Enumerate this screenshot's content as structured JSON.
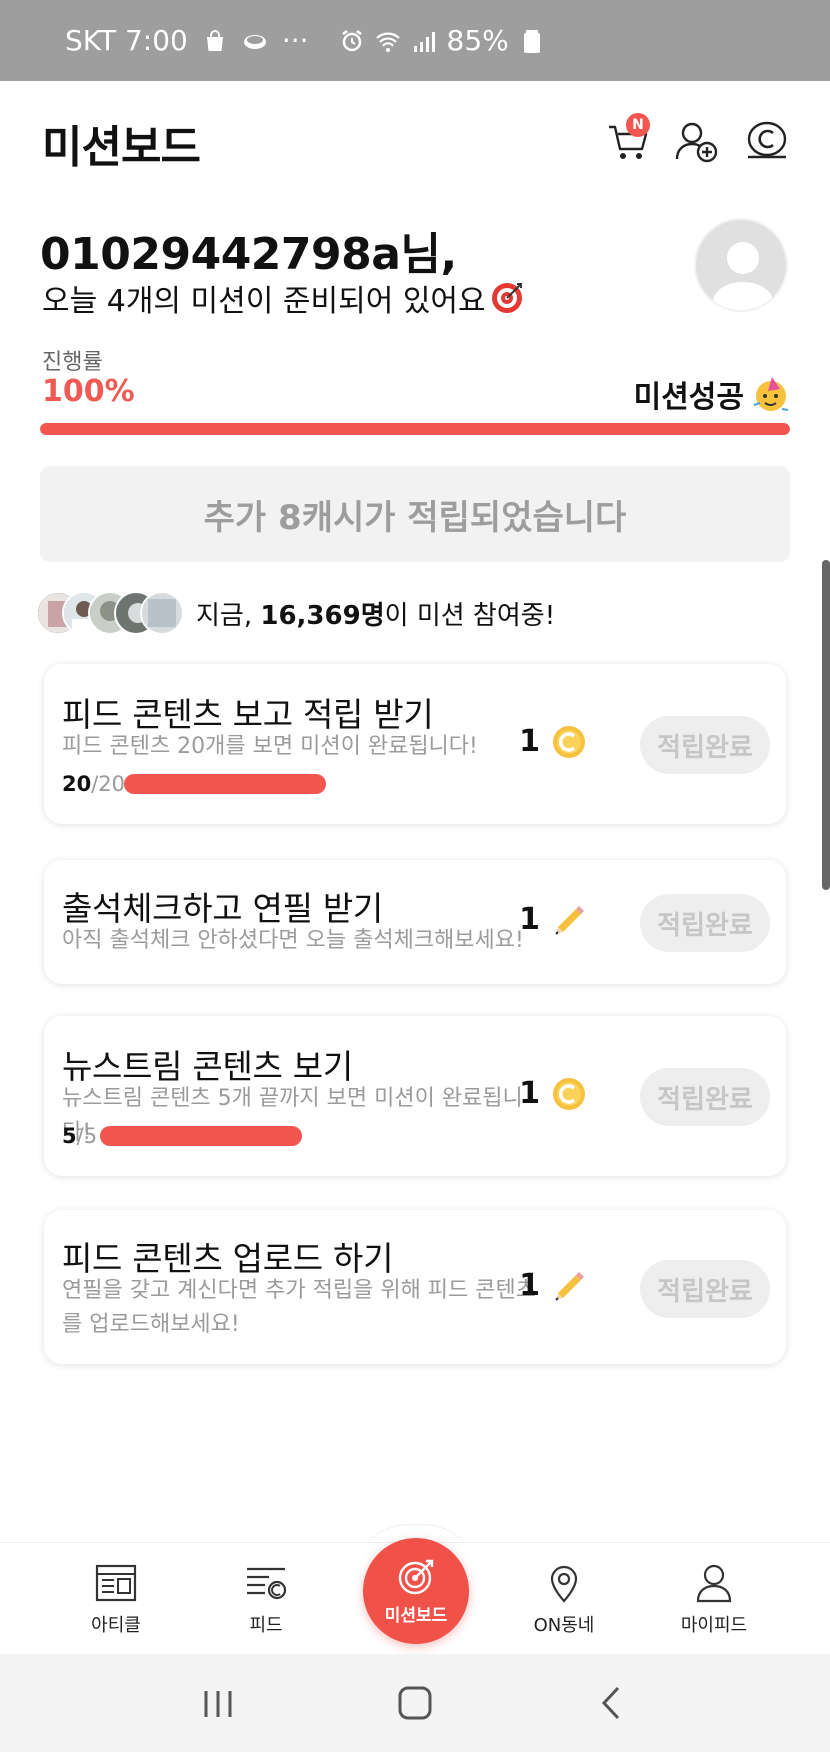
{
  "status_bar": {
    "carrier_time": "SKT 7:00",
    "dots": "···",
    "battery": "85%"
  },
  "header": {
    "title": "미션보드",
    "cart_badge": "N"
  },
  "greeting": {
    "name": "01029442798a님,",
    "message": "오늘 4개의 미션이 준비되어 있어요"
  },
  "progress": {
    "label": "진행률",
    "value": "100%",
    "fraction": 1.0,
    "success_label": "미션성공"
  },
  "banner": {
    "text": "추가 8캐시가 적립되었습니다"
  },
  "participants": {
    "prefix": "지금, ",
    "count": "16,369명",
    "suffix": "이 미션 참여중!"
  },
  "missions": [
    {
      "title": "피드 콘텐츠 보고 적립 받기",
      "desc": "피드 콘텐츠 20개를 보면 미션이 완료됩니다!",
      "done": "20",
      "total": "/20",
      "progress_fraction": 1.0,
      "reward": "1",
      "reward_icon": "coin-icon",
      "button": "적립완료"
    },
    {
      "title": "출석체크하고 연필 받기",
      "desc": "아직 출석체크 안하셨다면 오늘 출석체크해보세요!",
      "reward": "1",
      "reward_icon": "pencil-icon",
      "button": "적립완료"
    },
    {
      "title": "뉴스트림 콘텐츠 보기",
      "desc": "뉴스트림 콘텐츠 5개 끝까지 보면 미션이 완료됩니다!",
      "done": "5",
      "total": "/5",
      "progress_fraction": 1.0,
      "reward": "1",
      "reward_icon": "coin-icon",
      "button": "적립완료"
    },
    {
      "title": "피드 콘텐츠 업로드 하기",
      "desc": "연필을 갖고 계신다면 추가 적립을 위해 피드 콘텐츠를 업로드해보세요!",
      "reward": "1",
      "reward_icon": "pencil-icon",
      "button": "적립완료"
    }
  ],
  "bottom_nav": {
    "article": "아티클",
    "feed": "피드",
    "missionboard": "미션보드",
    "on_neighborhood": "ON동네",
    "my_feed": "마이피드"
  },
  "colors": {
    "accent": "#f2564e",
    "muted_text": "#9b9b9b",
    "banner_bg": "#f2f2f2",
    "coin": "#f6c23e"
  }
}
